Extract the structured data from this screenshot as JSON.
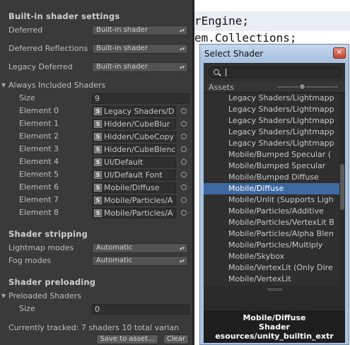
{
  "code_editor": {
    "lines": [
      "rEngine;",
      "em.Collections;"
    ]
  },
  "inspector": {
    "builtin_header": "Built-in shader settings",
    "rows": [
      {
        "label": "Deferred",
        "value": "Built-in shader"
      },
      {
        "label": "Deferred Reflections",
        "value": "Built-in shader"
      },
      {
        "label": "Legacy Deferred",
        "value": "Built-in shader"
      }
    ],
    "always_included": {
      "label": "Always Included Shaders",
      "size_label": "Size",
      "size_value": "9",
      "elements": [
        {
          "label": "Element 0",
          "value": "Legacy Shaders/D"
        },
        {
          "label": "Element 1",
          "value": "Hidden/CubeBlur"
        },
        {
          "label": "Element 2",
          "value": "Hidden/CubeCopy"
        },
        {
          "label": "Element 3",
          "value": "Hidden/CubeBlenc"
        },
        {
          "label": "Element 4",
          "value": "UI/Default"
        },
        {
          "label": "Element 5",
          "value": "UI/Default Font"
        },
        {
          "label": "Element 6",
          "value": "Mobile/Diffuse"
        },
        {
          "label": "Element 7",
          "value": "Mobile/Particles/A"
        },
        {
          "label": "Element 8",
          "value": "Mobile/Particles/A"
        }
      ],
      "shader_icon_letter": "S"
    },
    "stripping": {
      "header": "Shader stripping",
      "rows": [
        {
          "label": "Lightmap modes",
          "value": "Automatic"
        },
        {
          "label": "Fog modes",
          "value": "Automatic"
        }
      ]
    },
    "preloading": {
      "header": "Shader preloading",
      "preloaded_label": "Preloaded Shaders",
      "size_label": "Size",
      "size_value": "0"
    },
    "tracked_text": "Currently tracked: 7 shaders 10 total varian",
    "save_button": "Save to asset...",
    "clear_button": "Clear"
  },
  "dialog": {
    "title": "Select Shader",
    "close_glyph": "✕",
    "assets_label": "Assets",
    "items": [
      "Legacy Shaders/Lightmapp",
      "Legacy Shaders/Lightmapp",
      "Legacy Shaders/Lightmapp",
      "Legacy Shaders/Lightmapp",
      "Legacy Shaders/Lightmapp",
      "Mobile/Bumped Specular (",
      "Mobile/Bumped Specular",
      "Mobile/Bumped Diffuse",
      "Mobile/Diffuse",
      "Mobile/Unlit (Supports Ligh",
      "Mobile/Particles/Additive",
      "Mobile/Particles/VertexLit B",
      "Mobile/Particles/Alpha Blen",
      "Mobile/Particles/Multiply",
      "Mobile/Skybox",
      "Mobile/VertexLit (Only Dire",
      "Mobile/VertexLit"
    ],
    "selected_index": 8,
    "preview": {
      "name": "Mobile/Diffuse",
      "type": "Shader",
      "path": "esources/unity_builtin_extr"
    }
  }
}
